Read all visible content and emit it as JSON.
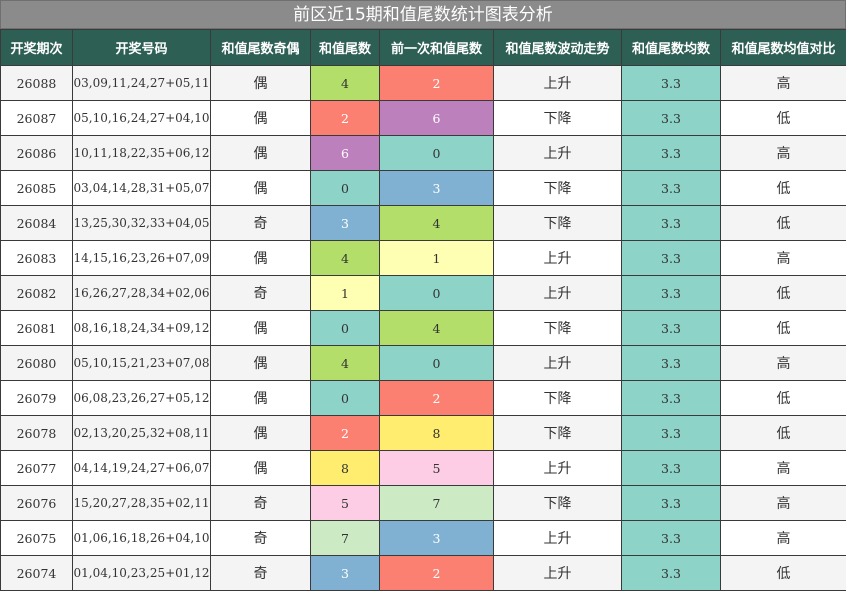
{
  "title": "前区近15期和值尾数统计图表分析",
  "headers": [
    "开奖期次",
    "开奖号码",
    "和值尾数奇偶",
    "和值尾数",
    "前一次和值尾数",
    "和值尾数波动走势",
    "和值尾数均数",
    "和值尾数均值对比"
  ],
  "colors": {
    "header_bg": "#2d5f55",
    "title_bg": "#8b8b8b",
    "avg_bg": "#8dd3c7",
    "digit_colors": {
      "0": "#8dd3c7",
      "1": "#ffffb3",
      "2": "#fb8072",
      "3": "#80b1d3",
      "4": "#b3de69",
      "5": "#fccde5",
      "6": "#bc80bd",
      "7": "#ccebc5",
      "8": "#ffed6f"
    }
  },
  "rows": [
    {
      "issue": "26088",
      "numbers": "03,09,11,24,27+05,11",
      "parity": "偶",
      "tail": "4",
      "prev_tail": "2",
      "trend": "上升",
      "avg": "3.3",
      "compare": "高"
    },
    {
      "issue": "26087",
      "numbers": "05,10,16,24,27+04,10",
      "parity": "偶",
      "tail": "2",
      "prev_tail": "6",
      "trend": "下降",
      "avg": "3.3",
      "compare": "低"
    },
    {
      "issue": "26086",
      "numbers": "10,11,18,22,35+06,12",
      "parity": "偶",
      "tail": "6",
      "prev_tail": "0",
      "trend": "上升",
      "avg": "3.3",
      "compare": "高"
    },
    {
      "issue": "26085",
      "numbers": "03,04,14,28,31+05,07",
      "parity": "偶",
      "tail": "0",
      "prev_tail": "3",
      "trend": "下降",
      "avg": "3.3",
      "compare": "低"
    },
    {
      "issue": "26084",
      "numbers": "13,25,30,32,33+04,05",
      "parity": "奇",
      "tail": "3",
      "prev_tail": "4",
      "trend": "下降",
      "avg": "3.3",
      "compare": "低"
    },
    {
      "issue": "26083",
      "numbers": "14,15,16,23,26+07,09",
      "parity": "偶",
      "tail": "4",
      "prev_tail": "1",
      "trend": "上升",
      "avg": "3.3",
      "compare": "高"
    },
    {
      "issue": "26082",
      "numbers": "16,26,27,28,34+02,06",
      "parity": "奇",
      "tail": "1",
      "prev_tail": "0",
      "trend": "上升",
      "avg": "3.3",
      "compare": "低"
    },
    {
      "issue": "26081",
      "numbers": "08,16,18,24,34+09,12",
      "parity": "偶",
      "tail": "0",
      "prev_tail": "4",
      "trend": "下降",
      "avg": "3.3",
      "compare": "低"
    },
    {
      "issue": "26080",
      "numbers": "05,10,15,21,23+07,08",
      "parity": "偶",
      "tail": "4",
      "prev_tail": "0",
      "trend": "上升",
      "avg": "3.3",
      "compare": "高"
    },
    {
      "issue": "26079",
      "numbers": "06,08,23,26,27+05,12",
      "parity": "偶",
      "tail": "0",
      "prev_tail": "2",
      "trend": "下降",
      "avg": "3.3",
      "compare": "低"
    },
    {
      "issue": "26078",
      "numbers": "02,13,20,25,32+08,11",
      "parity": "偶",
      "tail": "2",
      "prev_tail": "8",
      "trend": "下降",
      "avg": "3.3",
      "compare": "低"
    },
    {
      "issue": "26077",
      "numbers": "04,14,19,24,27+06,07",
      "parity": "偶",
      "tail": "8",
      "prev_tail": "5",
      "trend": "上升",
      "avg": "3.3",
      "compare": "高"
    },
    {
      "issue": "26076",
      "numbers": "15,20,27,28,35+02,11",
      "parity": "奇",
      "tail": "5",
      "prev_tail": "7",
      "trend": "下降",
      "avg": "3.3",
      "compare": "高"
    },
    {
      "issue": "26075",
      "numbers": "01,06,16,18,26+04,10",
      "parity": "奇",
      "tail": "7",
      "prev_tail": "3",
      "trend": "上升",
      "avg": "3.3",
      "compare": "高"
    },
    {
      "issue": "26074",
      "numbers": "01,04,10,23,25+01,12",
      "parity": "奇",
      "tail": "3",
      "prev_tail": "2",
      "trend": "上升",
      "avg": "3.3",
      "compare": "低"
    }
  ]
}
